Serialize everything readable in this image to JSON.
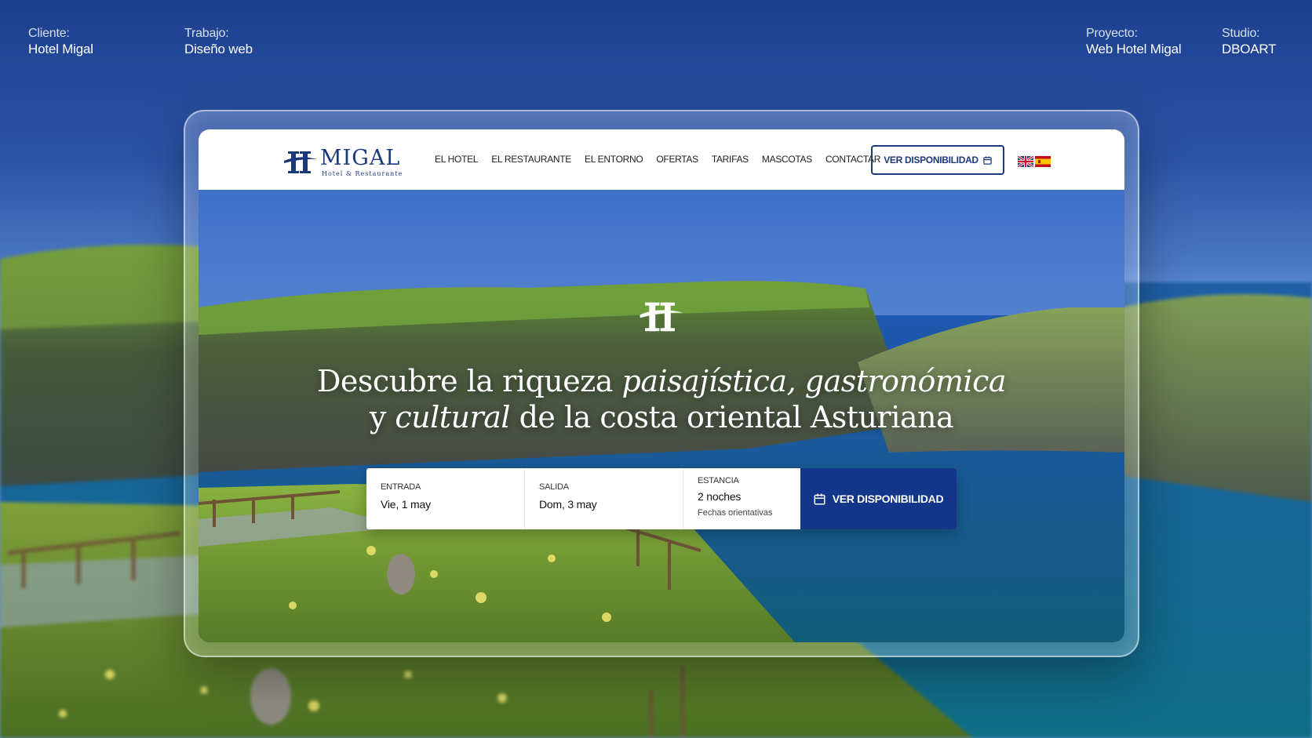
{
  "meta": {
    "client": {
      "label": "Cliente:",
      "value": "Hotel Migal"
    },
    "job": {
      "label": "Trabajo:",
      "value": "Diseño web"
    },
    "project": {
      "label": "Proyecto:",
      "value": "Web Hotel Migal"
    },
    "studio": {
      "label": "Studio:",
      "value": "DBOART"
    }
  },
  "site": {
    "logo": {
      "name": "MIGAL",
      "tagline": "Hotel & Restaurante"
    },
    "menu": [
      "EL HOTEL",
      "EL RESTAURANTE",
      "EL ENTORNO",
      "OFERTAS",
      "TARIFAS",
      "MASCOTAS",
      "CONTACTAR"
    ],
    "nav_button": "VER DISPONIBILIDAD",
    "languages": [
      "en",
      "es"
    ],
    "headline": {
      "part1": "Descubre la riqueza ",
      "em1": "paisajística, gastronómica",
      "part2": "y ",
      "em2": "cultural",
      "part3": " de la costa oriental Asturiana"
    },
    "booking": {
      "checkin": {
        "label": "ENTRADA",
        "value": "Vie, 1 may"
      },
      "checkout": {
        "label": "SALIDA",
        "value": "Dom, 3 may"
      },
      "stay": {
        "label": "ESTANCIA",
        "value": "2 noches",
        "note": "Fechas orientativas"
      },
      "button": "VER DISPONIBILIDAD"
    }
  },
  "colors": {
    "brand": "#1b3a7d",
    "button": "#13358a"
  },
  "icons": [
    "calendar-icon",
    "uk-flag-icon",
    "spain-flag-icon",
    "hotel-h-logo-icon"
  ]
}
